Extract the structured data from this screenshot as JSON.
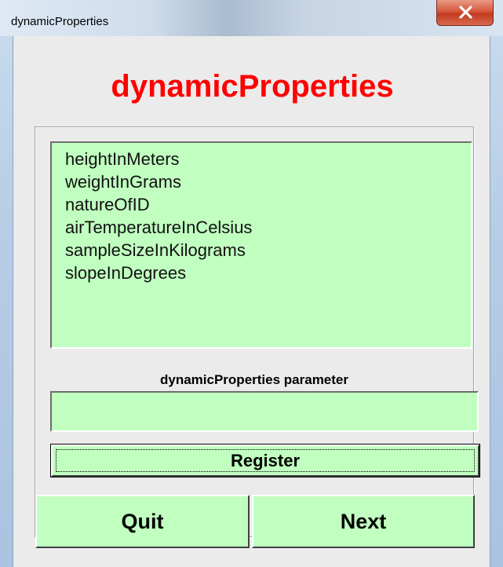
{
  "window": {
    "title": "dynamicProperties",
    "close_icon": "close-x-icon"
  },
  "form": {
    "heading": "dynamicProperties",
    "accent_color": "#ff0000",
    "control_color": "#c0ffc0"
  },
  "listbox": {
    "items": [
      "heightInMeters",
      "weightInGrams",
      "natureOfID",
      "airTemperatureInCelsius",
      "sampleSizeInKilograms",
      "slopeInDegrees"
    ]
  },
  "parameter": {
    "label": "dynamicProperties parameter",
    "value": ""
  },
  "buttons": {
    "register": "Register",
    "quit": "Quit",
    "next": "Next"
  }
}
